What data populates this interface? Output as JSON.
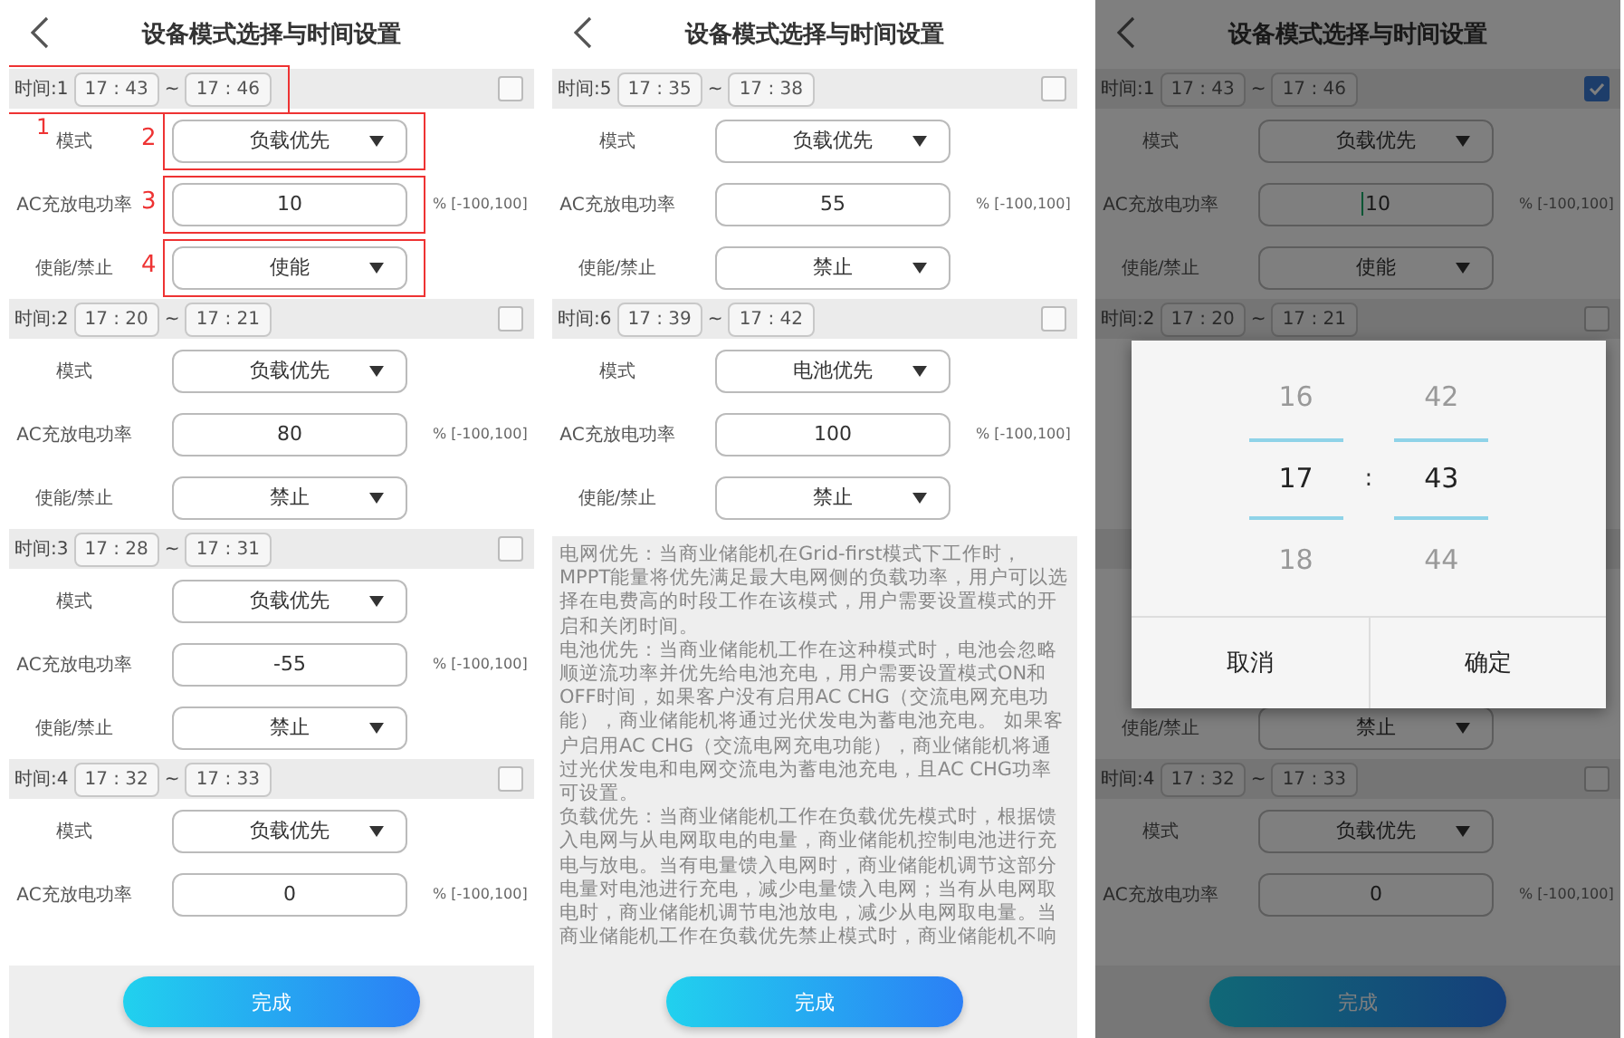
{
  "panels": [
    {
      "title": "设备模式选择与时间设置",
      "slots": [
        {
          "label": "时间:1",
          "start": "17 : 43",
          "tilde": "~",
          "end": "17 : 46",
          "checked": false,
          "annotation": "1",
          "rows": [
            {
              "kind": "select",
              "label": "模式",
              "value": "负载优先",
              "annotation": "2"
            },
            {
              "kind": "input",
              "label": "AC充放电功率",
              "value": "10",
              "range": "% [-100,100]",
              "annotation": "3"
            },
            {
              "kind": "select",
              "label": "使能/禁止",
              "value": "使能",
              "annotation": "4"
            }
          ]
        },
        {
          "label": "时间:2",
          "start": "17 : 20",
          "tilde": "~",
          "end": "17 : 21",
          "checked": false,
          "rows": [
            {
              "kind": "select",
              "label": "模式",
              "value": "负载优先"
            },
            {
              "kind": "input",
              "label": "AC充放电功率",
              "value": "80",
              "range": "% [-100,100]"
            },
            {
              "kind": "select",
              "label": "使能/禁止",
              "value": "禁止"
            }
          ]
        },
        {
          "label": "时间:3",
          "start": "17 : 28",
          "tilde": "~",
          "end": "17 : 31",
          "checked": false,
          "rows": [
            {
              "kind": "select",
              "label": "模式",
              "value": "负载优先"
            },
            {
              "kind": "input",
              "label": "AC充放电功率",
              "value": "-55",
              "range": "% [-100,100]"
            },
            {
              "kind": "select",
              "label": "使能/禁止",
              "value": "禁止"
            }
          ]
        },
        {
          "label": "时间:4",
          "start": "17 : 32",
          "tilde": "~",
          "end": "17 : 33",
          "checked": false,
          "rows": [
            {
              "kind": "select",
              "label": "模式",
              "value": "负载优先"
            },
            {
              "kind": "input",
              "label": "AC充放电功率",
              "value": "0",
              "range": "% [-100,100]"
            }
          ]
        }
      ],
      "button": "完成"
    },
    {
      "title": "设备模式选择与时间设置",
      "slots": [
        {
          "label": "时间:5",
          "start": "17 : 35",
          "tilde": "~",
          "end": "17 : 38",
          "checked": false,
          "rows": [
            {
              "kind": "select",
              "label": "模式",
              "value": "负载优先"
            },
            {
              "kind": "input",
              "label": "AC充放电功率",
              "value": "55",
              "range": "% [-100,100]"
            },
            {
              "kind": "select",
              "label": "使能/禁止",
              "value": "禁止"
            }
          ]
        },
        {
          "label": "时间:6",
          "start": "17 : 39",
          "tilde": "~",
          "end": "17 : 42",
          "checked": false,
          "rows": [
            {
              "kind": "select",
              "label": "模式",
              "value": "电池优先"
            },
            {
              "kind": "input",
              "label": "AC充放电功率",
              "value": "100",
              "range": "% [-100,100]"
            },
            {
              "kind": "select",
              "label": "使能/禁止",
              "value": "禁止"
            }
          ]
        }
      ],
      "description": [
        "电网优先：当商业储能机在Grid-first模式下工作时，MPPT能量将优先满足最大电网侧的负载功率，用户可以选择在电费高的时段工作在该模式，用户需要设置模式的开启和关闭时间。",
        "电池优先：当商业储能机工作在这种模式时，电池会忽略顺逆流功率并优先给电池充电，用户需要设置模式ON和OFF时间，如果客户没有启用AC CHG（交流电网充电功能），商业储能机将通过光伏发电为蓄电池充电。 如果客户启用AC CHG（交流电网充电功能），商业储能机将通过光伏发电和电网交流电为蓄电池充电，且AC CHG功率可设置。",
        "负载优先：当商业储能机工作在负载优先模式时，根据馈入电网与从电网取电的电量，商业储能机控制电池进行充电与放电。当有电量馈入电网时，商业储能机调节这部分电量对电池进行充电，减少电量馈入电网；当有从电网取电时，商业储能机调节电池放电，减少从电网取电量。当商业储能机工作在负载优先禁止模式时，商业储能机不响"
      ],
      "button": "完成"
    },
    {
      "title": "设备模式选择与时间设置",
      "dimmed": true,
      "slots": [
        {
          "label": "时间:1",
          "start": "17 : 43",
          "tilde": "~",
          "end": "17 : 46",
          "checked": true,
          "rows": [
            {
              "kind": "select",
              "label": "模式",
              "value": "负载优先"
            },
            {
              "kind": "input",
              "label": "AC充放电功率",
              "value": "10",
              "range": "% [-100,100]",
              "focused": true
            },
            {
              "kind": "select",
              "label": "使能/禁止",
              "value": "使能"
            }
          ]
        },
        {
          "label": "时间:2",
          "start": "17 : 20",
          "tilde": "~",
          "end": "17 : 21",
          "checked": false,
          "rows": [
            {
              "kind": "blank"
            },
            {
              "kind": "blank"
            },
            {
              "kind": "blank"
            }
          ]
        },
        {
          "rows": [
            {
              "kind": "blank"
            },
            {
              "kind": "blank"
            },
            {
              "kind": "select",
              "label": "使能/禁止",
              "value": "禁止"
            }
          ]
        },
        {
          "label": "时间:4",
          "start": "17 : 32",
          "tilde": "~",
          "end": "17 : 33",
          "checked": false,
          "rows": [
            {
              "kind": "select",
              "label": "模式",
              "value": "负载优先"
            },
            {
              "kind": "input",
              "label": "AC充放电功率",
              "value": "0",
              "range": "% [-100,100]"
            }
          ]
        }
      ],
      "dialog": {
        "hours": [
          {
            "value": "16",
            "selected": false
          },
          {
            "value": "17",
            "selected": true
          },
          {
            "value": "18",
            "selected": false
          }
        ],
        "separator": ":",
        "minutes": [
          {
            "value": "42",
            "selected": false
          },
          {
            "value": "43",
            "selected": true
          },
          {
            "value": "44",
            "selected": false
          }
        ],
        "buttons": [
          "取消",
          "确定"
        ]
      },
      "button": "完成"
    }
  ]
}
